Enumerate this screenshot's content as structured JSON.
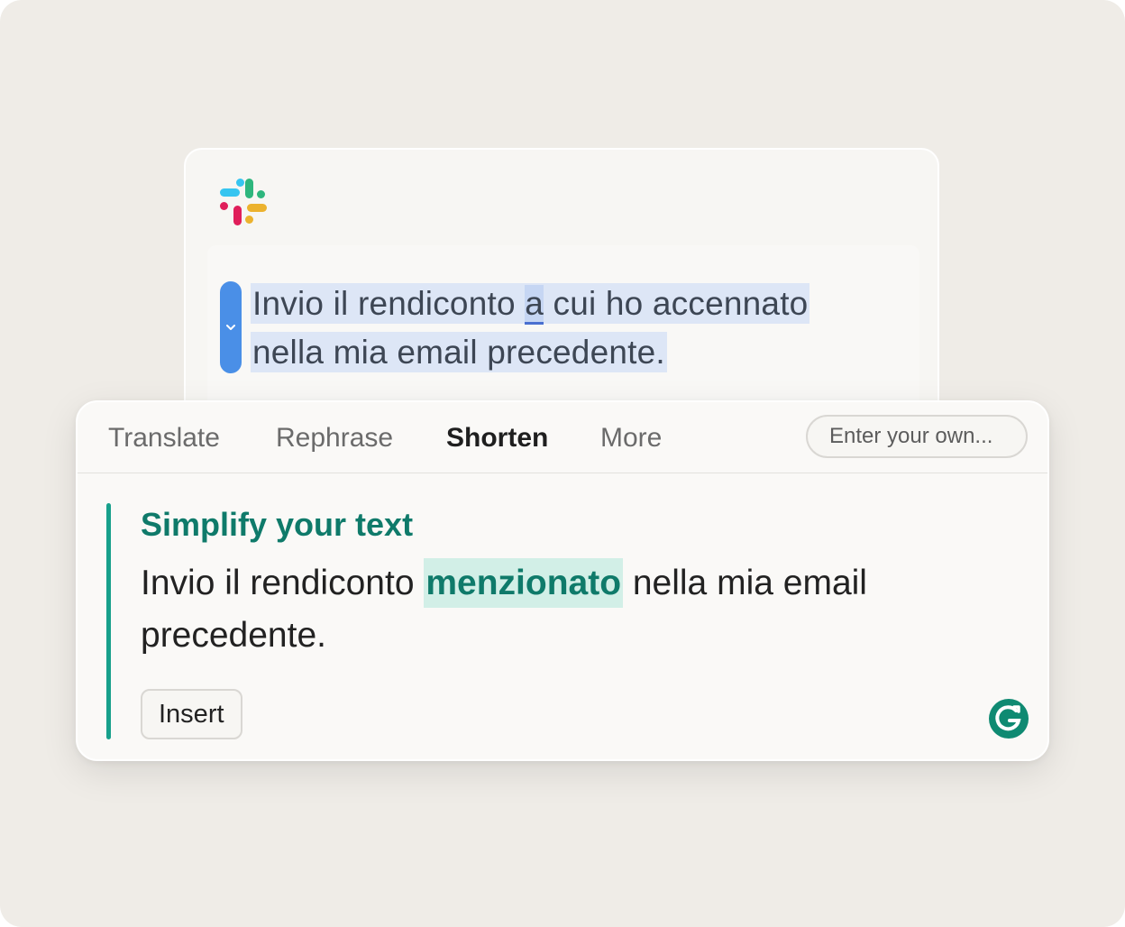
{
  "composer": {
    "text_part1": "Invio il rendiconto ",
    "text_word": "a",
    "text_part2": " cui ho accennato",
    "text_line2": "nella mia email precedente."
  },
  "popup": {
    "tabs": [
      {
        "label": "Translate",
        "active": false
      },
      {
        "label": "Rephrase",
        "active": false
      },
      {
        "label": "Shorten",
        "active": true
      },
      {
        "label": "More",
        "active": false
      }
    ],
    "custom_prompt_placeholder": "Enter your own..."
  },
  "suggestion": {
    "title": "Simplify your text",
    "text_before": "Invio il rendiconto ",
    "replacement": "menzionato",
    "text_after": " nella mia email precedente.",
    "insert_label": "Insert"
  },
  "colors": {
    "accent": "#17a08b",
    "handle": "#4a8fe7",
    "selection": "#dde6f6"
  },
  "icons": [
    "slack-logo-icon",
    "chevron-down-icon",
    "grammarly-logo-icon"
  ]
}
